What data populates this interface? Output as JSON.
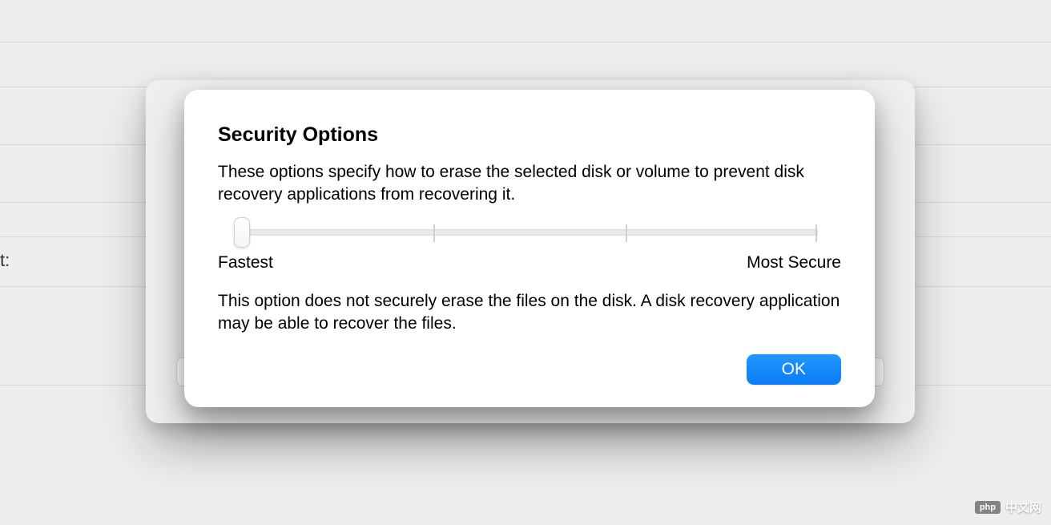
{
  "background": {
    "partial_label": "t:"
  },
  "dialog": {
    "title": "Security Options",
    "description": "These options specify how to erase the selected disk or volume to prevent disk recovery applications from recovering it.",
    "slider": {
      "min_label": "Fastest",
      "max_label": "Most Secure",
      "position": 0,
      "steps": 4
    },
    "explanation": "This option does not securely erase the files on the disk. A disk recovery application may be able to recover the files.",
    "ok_label": "OK"
  },
  "watermark": {
    "badge": "php",
    "text": "中文网"
  }
}
